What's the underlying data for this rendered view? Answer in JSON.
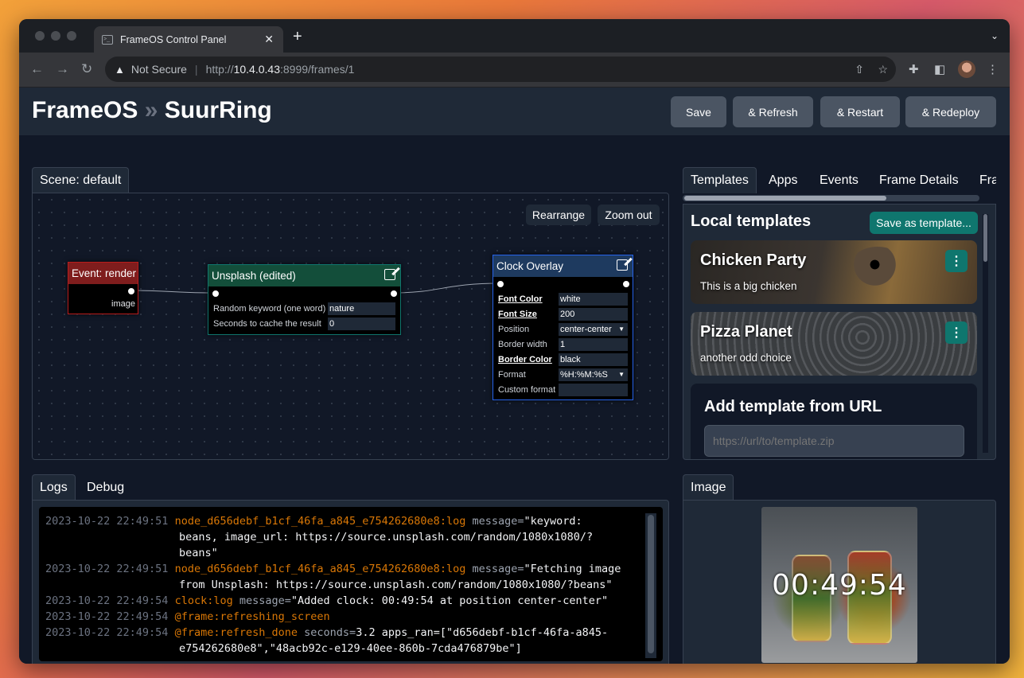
{
  "browser": {
    "tab_title": "FrameOS Control Panel",
    "tab_close": "✕",
    "new_tab": "+",
    "tab_menu": "⌄",
    "security_label": "Not Secure",
    "url_scheme": "http://",
    "url_host": "10.4.0.43",
    "url_rest": ":8999/frames/1"
  },
  "header": {
    "title_app": "FrameOS",
    "title_sep": "»",
    "title_frame": "SuurRing",
    "buttons": {
      "save": "Save",
      "refresh": "& Refresh",
      "restart": "& Restart",
      "redeploy": "& Redeploy"
    }
  },
  "scene": {
    "tab_label": "Scene: default",
    "rearrange": "Rearrange",
    "zoom_out": "Zoom out",
    "nodes": {
      "event": {
        "title": "Event: render",
        "output": "image",
        "color": "#7f1d1d"
      },
      "unsplash": {
        "title": "Unsplash (edited)",
        "color": "#134e3a",
        "fields": [
          {
            "label": "Random keyword (one word)",
            "value": "nature"
          },
          {
            "label": "Seconds to cache the result",
            "value": "0"
          }
        ]
      },
      "clock": {
        "title": "Clock Overlay",
        "color": "#1e3a5f",
        "fields": [
          {
            "label": "Font Color",
            "value": "white"
          },
          {
            "label": "Font Size",
            "value": "200"
          },
          {
            "label": "Position",
            "value": "center-center"
          },
          {
            "label": "Border width",
            "value": "1"
          },
          {
            "label": "Border Color",
            "value": "black"
          },
          {
            "label": "Format",
            "value": "%H:%M:%S"
          },
          {
            "label": "Custom format",
            "value": ""
          }
        ]
      }
    }
  },
  "right_panel": {
    "tabs": [
      "Templates",
      "Apps",
      "Events",
      "Frame Details",
      "Fra"
    ],
    "section_title": "Local templates",
    "save_as_template": "Save as template...",
    "templates": [
      {
        "name": "Chicken Party",
        "description": "This is a big chicken"
      },
      {
        "name": "Pizza Planet",
        "description": "another odd choice"
      }
    ],
    "menu_glyph": "⋮",
    "add_url_title": "Add template from URL",
    "add_url_placeholder": "https://url/to/template.zip"
  },
  "logs_panel": {
    "tabs": [
      "Logs",
      "Debug"
    ],
    "lines": [
      {
        "ts": "2023-10-22 22:49:51",
        "node": "node_d656debf_b1cf_46fa_a845_e754262680e8:log",
        "key": "message=",
        "val": "\"keyword:"
      },
      {
        "ts": "",
        "node": "",
        "key": "",
        "val": "beans, image_url: https://source.unsplash.com/random/1080x1080/?"
      },
      {
        "ts": "",
        "node": "",
        "key": "",
        "val": "beans\""
      },
      {
        "ts": "2023-10-22 22:49:51",
        "node": "node_d656debf_b1cf_46fa_a845_e754262680e8:log",
        "key": "message=",
        "val": "\"Fetching image"
      },
      {
        "ts": "",
        "node": "",
        "key": "",
        "val": "from Unsplash: https://source.unsplash.com/random/1080x1080/?beans\""
      },
      {
        "ts": "2023-10-22 22:49:54",
        "node": "clock:log",
        "key": "message=",
        "val": "\"Added clock: 00:49:54 at position center-center\""
      },
      {
        "ts": "2023-10-22 22:49:54",
        "node": "@frame:refreshing_screen",
        "key": "",
        "val": ""
      },
      {
        "ts": "2023-10-22 22:49:54",
        "node": "@frame:refresh_done",
        "key": "seconds=",
        "val": "3.2 apps_ran=[\"d656debf-b1cf-46fa-a845-"
      },
      {
        "ts": "",
        "node": "",
        "key": "",
        "val": "e754262680e8\",\"48acb92c-e129-40ee-860b-7cda476879be\"]"
      }
    ]
  },
  "image_panel": {
    "tab_label": "Image",
    "clock_text": "00:49:54"
  },
  "colors": {
    "accent_teal": "#0f766e",
    "log_timestamp": "#6b7280",
    "log_node": "#d97706"
  }
}
